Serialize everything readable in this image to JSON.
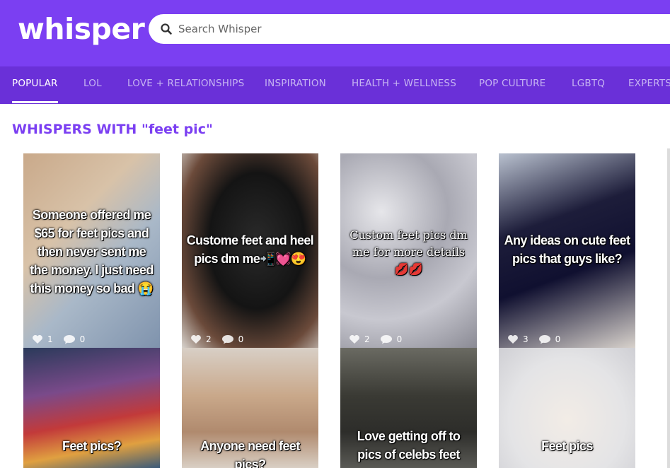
{
  "header": {
    "logo": "whisper",
    "search_placeholder": "Search Whisper"
  },
  "nav": {
    "tabs": [
      {
        "label": "POPULAR",
        "active": true
      },
      {
        "label": "LOL"
      },
      {
        "label": "LOVE + RELATIONSHIPS"
      },
      {
        "label": "INSPIRATION"
      },
      {
        "label": "HEALTH + WELLNESS"
      },
      {
        "label": "POP CULTURE"
      },
      {
        "label": "LGBTQ"
      },
      {
        "label": "EXPERTS"
      }
    ]
  },
  "main": {
    "heading": "WHISPERS WITH \"feet pic\"",
    "cards": [
      {
        "text": "Someone offered me $65 for feet pics and then never sent me the money. I just need this money so bad 😭",
        "hearts": "1",
        "replies": "0"
      },
      {
        "text": "Custome feet and heel pics dm me📲💓😍",
        "hearts": "2",
        "replies": "0"
      },
      {
        "text": "Custom feet pics dm me for more details 💋💋",
        "hearts": "2",
        "replies": "0"
      },
      {
        "text": "Any ideas on cute feet pics that guys like?",
        "hearts": "3",
        "replies": "0"
      },
      {
        "text": "Feet pics?"
      },
      {
        "text": "Anyone need feet pics?"
      },
      {
        "text": "Love getting off to pics of celebs feet"
      },
      {
        "text": "Feet pics"
      }
    ]
  }
}
